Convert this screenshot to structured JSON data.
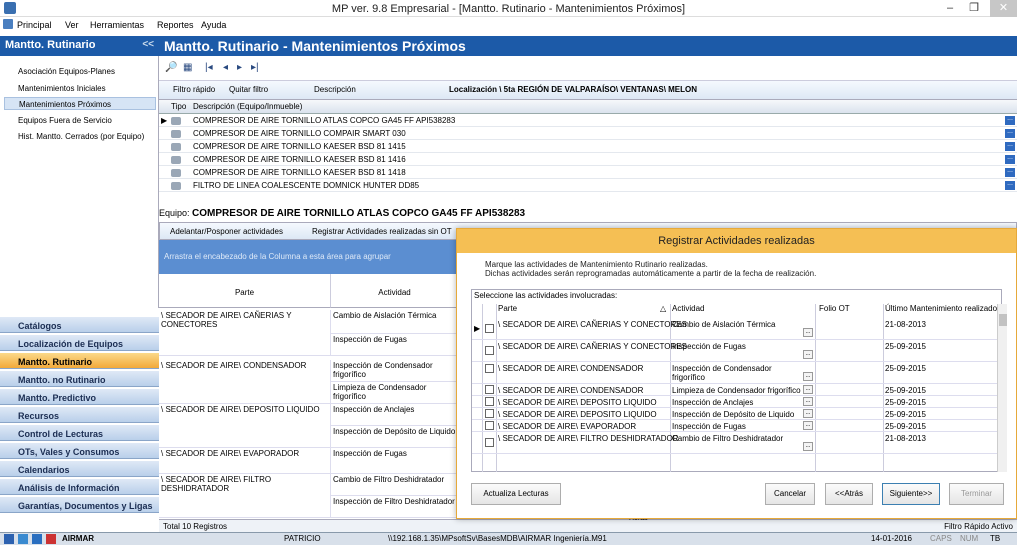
{
  "window": {
    "title": "MP ver. 9.8 Empresarial - [Mantto. Rutinario - Mantenimientos Próximos]",
    "min": "–",
    "max": "❐",
    "close": "✕"
  },
  "menu": [
    "Principal",
    "Ver",
    "Herramientas",
    "Reportes",
    "Ayuda"
  ],
  "sidebar": {
    "title": "Mantto. Rutinario",
    "collapse": "<<",
    "items": [
      "Asociación Equipos-Planes",
      "Mantenimientos Iniciales",
      "Mantenimientos Próximos",
      "Equipos Fuera de Servicio",
      "Hist. Mantto. Cerrados (por Equipo)"
    ],
    "nav": [
      "Catálogos",
      "Localización de Equipos",
      "Mantto. Rutinario",
      "Mantto. no Rutinario",
      "Mantto. Predictivo",
      "Recursos",
      "Control de Lecturas",
      "OTs, Vales y Consumos",
      "Calendarios",
      "Análisis de Información",
      "Garantías, Documentos y Ligas"
    ]
  },
  "main": {
    "title": "Mantto. Rutinario - Mantenimientos Próximos",
    "toolbar1": [
      "🔎",
      "▦",
      "|◂",
      "◂",
      "▸",
      "▸|"
    ],
    "filter_quick": "Filtro rápido",
    "filter_remove": "Quitar filtro",
    "description": "Descripción",
    "location": "Localización \\ 5ta REGIÓN DE VALPARAÍSO\\ VENTANAS\\ MELON",
    "grid1_header_tipo": "Tipo",
    "grid1_header_desc": "Descripción (Equipo/Inmueble)",
    "equipment": [
      "COMPRESOR DE AIRE TORNILLO ATLAS COPCO GA45 FF API538283",
      "COMPRESOR DE AIRE TORNILLO COMPAIR SMART 030",
      "COMPRESOR DE AIRE TORNILLO KAESER BSD 81 1415",
      "COMPRESOR DE AIRE TORNILLO KAESER BSD 81 1416",
      "COMPRESOR DE AIRE TORNILLO KAESER BSD 81 1418",
      "FILTRO DE LINEA COALESCENTE DOMNICK HUNTER DD85"
    ],
    "equipo_label": "Equipo:",
    "equipo_value": "COMPRESOR DE AIRE TORNILLO ATLAS COPCO GA45 FF API538283",
    "btn_postpone": "Adelantar/Posponer actividades",
    "btn_register": "Registrar Actividades realizadas sin OT",
    "group_hint": "Arrastra el encabezado de la Columna a esta área para agrupar",
    "col_parte": "Parte",
    "col_actividad": "Actividad",
    "rows": [
      {
        "parte": "\\ SECADOR DE AIRE\\ CAÑERIAS Y CONECTORES",
        "acts": [
          "Cambio de Aislación Térmica",
          "Inspección de Fugas"
        ]
      },
      {
        "parte": "\\ SECADOR DE AIRE\\ CONDENSADOR",
        "acts": [
          "Inspección de Condensador frigorífico",
          "Limpieza de Condensador frigorífico"
        ]
      },
      {
        "parte": "\\ SECADOR DE AIRE\\ DEPOSITO LIQUIDO",
        "acts": [
          "Inspección de Anclajes",
          "Inspección de Depósito de Liquido"
        ]
      },
      {
        "parte": "\\ SECADOR DE AIRE\\ EVAPORADOR",
        "acts": [
          "Inspección de Fugas"
        ]
      },
      {
        "parte": "\\ SECADOR DE AIRE\\ FILTRO DESHIDRATADOR",
        "acts": [
          "Cambio de Filtro Deshidratador",
          "Inspección de Filtro Deshidratador"
        ]
      }
    ],
    "total": "Total 10 Registros",
    "horas": "Horas",
    "filter_status": "Filtro Rápido Activo"
  },
  "dialog": {
    "title": "Registrar Actividades realizadas",
    "msg1": "Marque las actividades de Mantenimiento Rutinario realizadas.",
    "msg2": "Dichas actividades serán reprogramadas automáticamente a partir de la fecha de realización.",
    "select_label": "Seleccione las actividades involucradas:",
    "headers": {
      "parte": "Parte",
      "actividad": "Actividad",
      "folio": "Folio OT",
      "ultimo": "Último Mantenimiento realizado"
    },
    "rows": [
      {
        "parte": "\\ SECADOR DE AIRE\\ CAÑERIAS Y CONECTORES",
        "act": "Cambio de Aislación Térmica",
        "fecha": "21-08-2013"
      },
      {
        "parte": "\\ SECADOR DE AIRE\\ CAÑERIAS Y CONECTORES",
        "act": "Inspección de Fugas",
        "fecha": "25-09-2015"
      },
      {
        "parte": "\\ SECADOR DE AIRE\\ CONDENSADOR",
        "act": "Inspección de Condensador frigorífico",
        "fecha": "25-09-2015"
      },
      {
        "parte": "\\ SECADOR DE AIRE\\ CONDENSADOR",
        "act": "Limpieza de Condensador frigorífico",
        "fecha": "25-09-2015"
      },
      {
        "parte": "\\ SECADOR DE AIRE\\ DEPOSITO LIQUIDO",
        "act": "Inspección de Anclajes",
        "fecha": "25-09-2015"
      },
      {
        "parte": "\\ SECADOR DE AIRE\\ DEPOSITO LIQUIDO",
        "act": "Inspección de Depósito de Liquido",
        "fecha": "25-09-2015"
      },
      {
        "parte": "\\ SECADOR DE AIRE\\ EVAPORADOR",
        "act": "Inspección de Fugas",
        "fecha": "25-09-2015"
      },
      {
        "parte": "\\ SECADOR DE AIRE\\ FILTRO DESHIDRATADOR",
        "act": "Cambio de Filtro Deshidratador",
        "fecha": "21-08-2013"
      }
    ],
    "btn_update": "Actualiza Lecturas",
    "btn_cancel": "Cancelar",
    "btn_back": "<<Atrás",
    "btn_next": "Siguiente>>",
    "btn_finish": "Terminar"
  },
  "taskbar": {
    "app": "AIRMAR",
    "user": "PATRICIO",
    "path": "\\\\192.168.1.35\\MPsoftSv\\BasesMDB\\AIRMAR Ingeniería.M91",
    "date": "14-01-2016",
    "caps": "CAPS",
    "num": "NUM",
    "tb": "TB"
  }
}
